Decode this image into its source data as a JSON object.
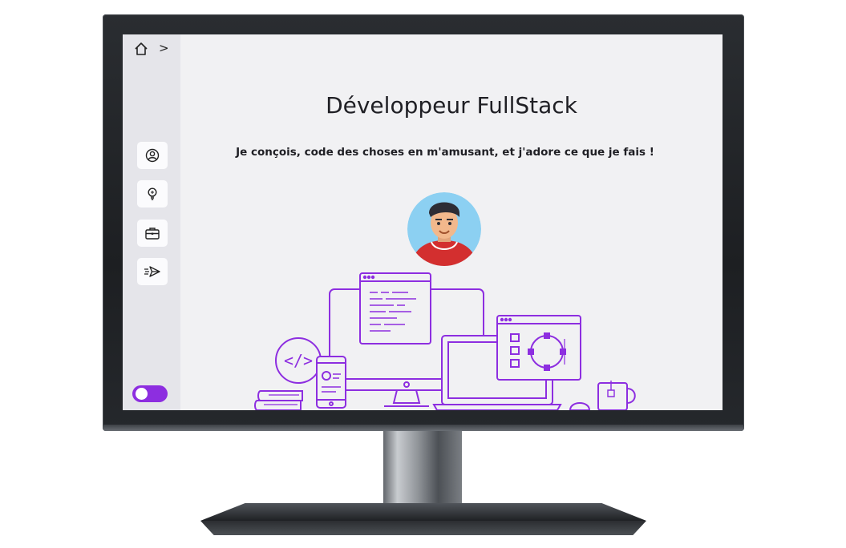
{
  "hero": {
    "title": "Développeur FullStack",
    "subtitle": "Je conçois, code des choses en m'amusant, et j'adore ce que je fais !"
  },
  "breadcrumb": {
    "separator": ">"
  },
  "sidebar": {
    "items": [
      {
        "icon": "user-circle-icon"
      },
      {
        "icon": "lightbulb-icon"
      },
      {
        "icon": "briefcase-icon"
      },
      {
        "icon": "send-icon"
      }
    ]
  },
  "theme_toggle": {
    "state": "on"
  },
  "illustration": {
    "code_icon_text": "</>"
  },
  "colors": {
    "accent": "#8d2ee0",
    "background": "#f1f1f3",
    "sidebar": "#e5e5ea",
    "text": "#1f1f24",
    "avatar_bg": "#8cd0f2",
    "hoodie": "#d32f2f"
  }
}
